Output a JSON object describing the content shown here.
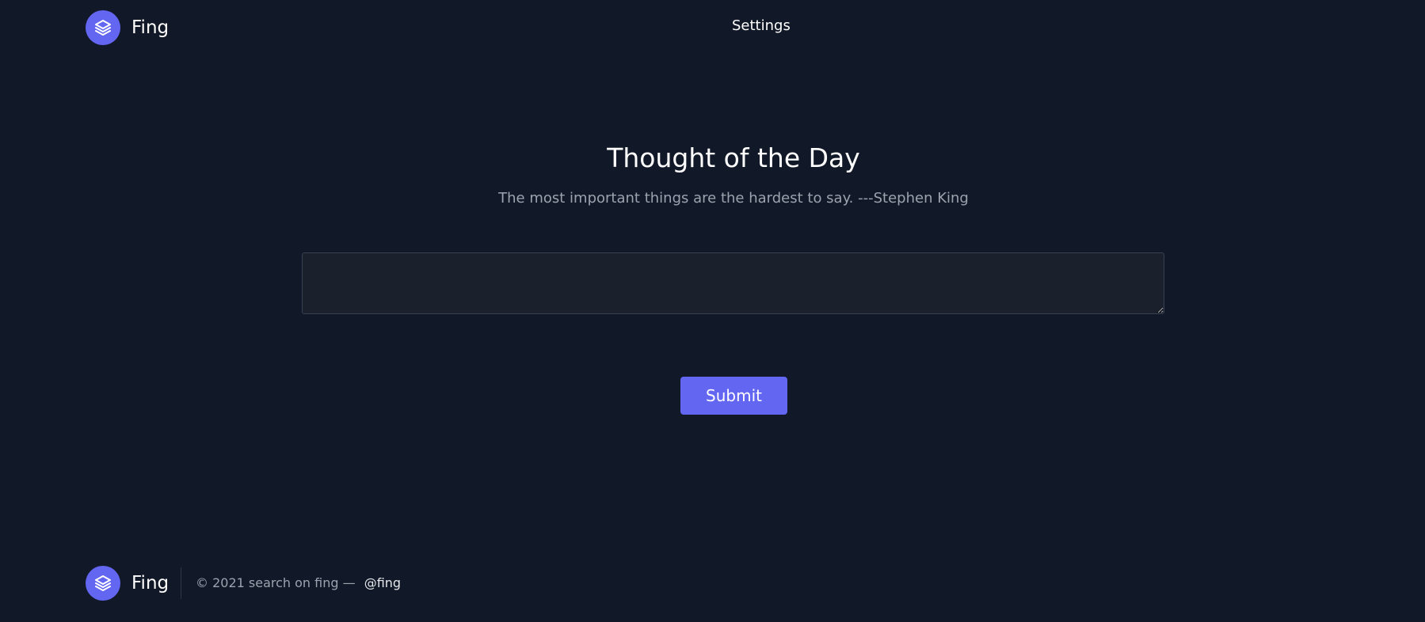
{
  "header": {
    "brand_name": "Fing",
    "logo_icon": "layers-icon",
    "nav": {
      "settings_label": "Settings"
    }
  },
  "main": {
    "title": "Thought of the Day",
    "quote": "The most important things are the hardest to say. ---Stephen King",
    "textarea": {
      "value": "",
      "placeholder": ""
    },
    "submit_label": "Submit"
  },
  "footer": {
    "brand_name": "Fing",
    "logo_icon": "layers-icon",
    "copyright": "© 2021 search on fing —",
    "handle": "@fing"
  },
  "colors": {
    "background": "#111827",
    "accent": "#6366f1",
    "muted_text": "#9ca3af",
    "input_background": "#1a202c",
    "input_border": "#374151"
  }
}
